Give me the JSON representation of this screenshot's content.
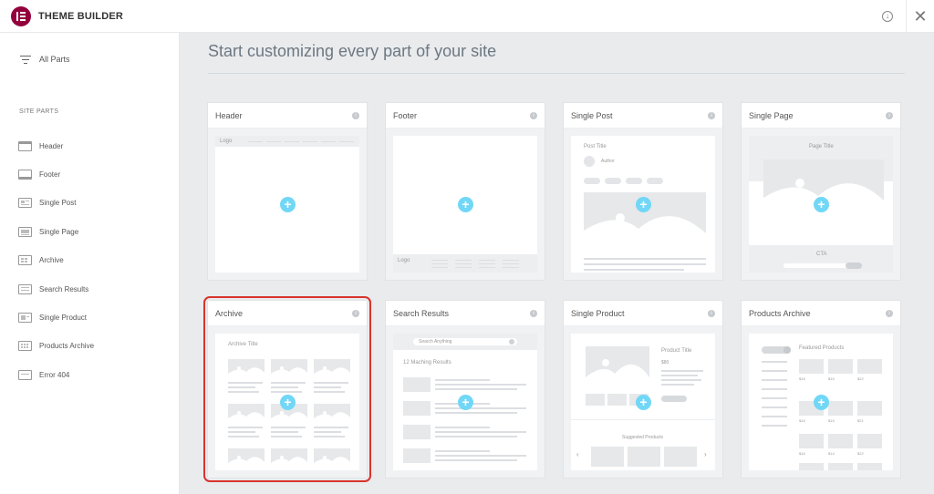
{
  "app": {
    "title": "THEME BUILDER"
  },
  "sidebar": {
    "all_parts": "All Parts",
    "section_label": "SITE PARTS",
    "items": [
      {
        "label": "Header",
        "icon": "header-icon"
      },
      {
        "label": "Footer",
        "icon": "footer-icon"
      },
      {
        "label": "Single Post",
        "icon": "single-post-icon"
      },
      {
        "label": "Single Page",
        "icon": "single-page-icon"
      },
      {
        "label": "Archive",
        "icon": "archive-icon"
      },
      {
        "label": "Search Results",
        "icon": "search-results-icon"
      },
      {
        "label": "Single Product",
        "icon": "single-product-icon"
      },
      {
        "label": "Products Archive",
        "icon": "products-archive-icon"
      },
      {
        "label": "Error 404",
        "icon": "error-404-icon"
      }
    ]
  },
  "main": {
    "heading": "Start customizing every part of your site",
    "cards": [
      {
        "title": "Header"
      },
      {
        "title": "Footer"
      },
      {
        "title": "Single Post"
      },
      {
        "title": "Single Page"
      },
      {
        "title": "Archive",
        "selected": true
      },
      {
        "title": "Search Results"
      },
      {
        "title": "Single Product"
      },
      {
        "title": "Products Archive"
      }
    ],
    "previews": {
      "header": {
        "logo": "Logo"
      },
      "footer": {
        "logo": "Logo"
      },
      "single_post": {
        "post_title": "Post Title",
        "author": "Author"
      },
      "single_page": {
        "page_title": "Page Title",
        "cta": "CTA"
      },
      "archive": {
        "archive_title": "Archive Title"
      },
      "search_results": {
        "search_placeholder": "Search Anything",
        "results": "12 Maching Results"
      },
      "single_product": {
        "product_title": "Product Title",
        "price": "$80",
        "suggested": "Suggested Products"
      },
      "products_archive": {
        "featured": "Featured Products",
        "prices": [
          "$16",
          "$15",
          "$22",
          "$16",
          "$15",
          "$21",
          "$16",
          "$14",
          "$22"
        ]
      }
    }
  },
  "colors": {
    "brand": "#93003c",
    "accent": "#71d7f7",
    "selected_outline": "#d9342b"
  }
}
